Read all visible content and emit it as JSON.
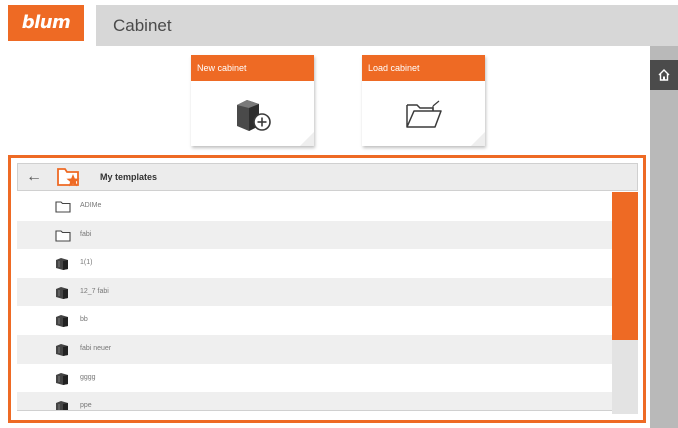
{
  "brand": {
    "logo": "blum",
    "accent": "#ee6a24"
  },
  "window": {
    "title": "Cabinet"
  },
  "tiles": [
    {
      "label": "New cabinet",
      "icon": "new-cabinet-icon"
    },
    {
      "label": "Load cabinet",
      "icon": "open-folder-icon"
    }
  ],
  "rail": {
    "home_icon": "home-icon"
  },
  "templates": {
    "title": "My templates",
    "back_icon": "back-arrow-icon",
    "folder_icon": "template-folder-star-icon",
    "items": [
      {
        "label": "ADIMe",
        "type": "folder"
      },
      {
        "label": "fabi",
        "type": "folder"
      },
      {
        "label": "1(1)",
        "type": "cabinet"
      },
      {
        "label": "12_7 fabi",
        "type": "cabinet"
      },
      {
        "label": "bb",
        "type": "cabinet"
      },
      {
        "label": "fabi neuer",
        "type": "cabinet"
      },
      {
        "label": "gggg",
        "type": "cabinet"
      },
      {
        "label": "ppe",
        "type": "cabinet"
      }
    ]
  }
}
